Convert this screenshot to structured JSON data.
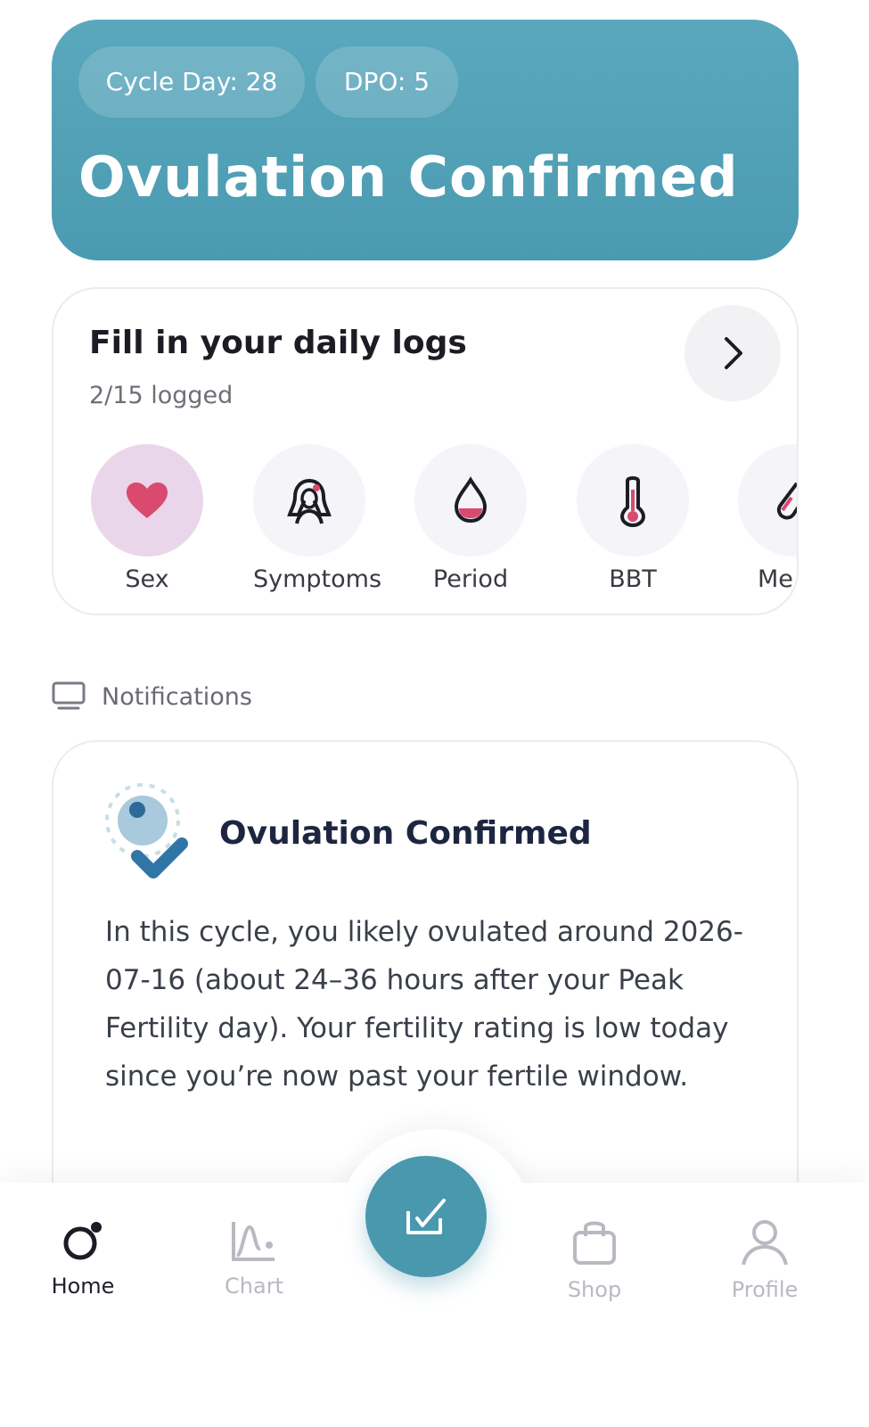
{
  "hero": {
    "cycle_day": "Cycle Day: 28",
    "dpo": "DPO: 5",
    "title": "Ovulation Confirmed"
  },
  "daily_logs": {
    "title": "Fill in your daily logs",
    "subtitle": "2/15 logged",
    "items": [
      {
        "label": "Sex",
        "icon": "heart-icon"
      },
      {
        "label": "Symptoms",
        "icon": "symptoms-icon"
      },
      {
        "label": "Period",
        "icon": "drop-icon"
      },
      {
        "label": "BBT",
        "icon": "thermometer-icon"
      },
      {
        "label": "Me",
        "icon": "medication-icon"
      }
    ]
  },
  "notifications": {
    "heading": "Notifications",
    "card": {
      "title": "Ovulation Confirmed",
      "body": "In this cycle, you likely ovulated around 2026-07-16 (about 24–36 hours after your Peak Fertility day). Your fertility rating is low today since you’re now past your fertile window."
    }
  },
  "nav": {
    "items": [
      {
        "label": "Home",
        "icon": "home-icon"
      },
      {
        "label": "Chart",
        "icon": "chart-icon"
      },
      {
        "label": "Shop",
        "icon": "shop-bag-icon"
      },
      {
        "label": "Profile",
        "icon": "profile-icon"
      }
    ],
    "fab_icon": "log-check-icon"
  },
  "colors": {
    "accent": "#4a98ae",
    "heart": "#d94a6e",
    "active_log_bg": "#ead6ea"
  }
}
